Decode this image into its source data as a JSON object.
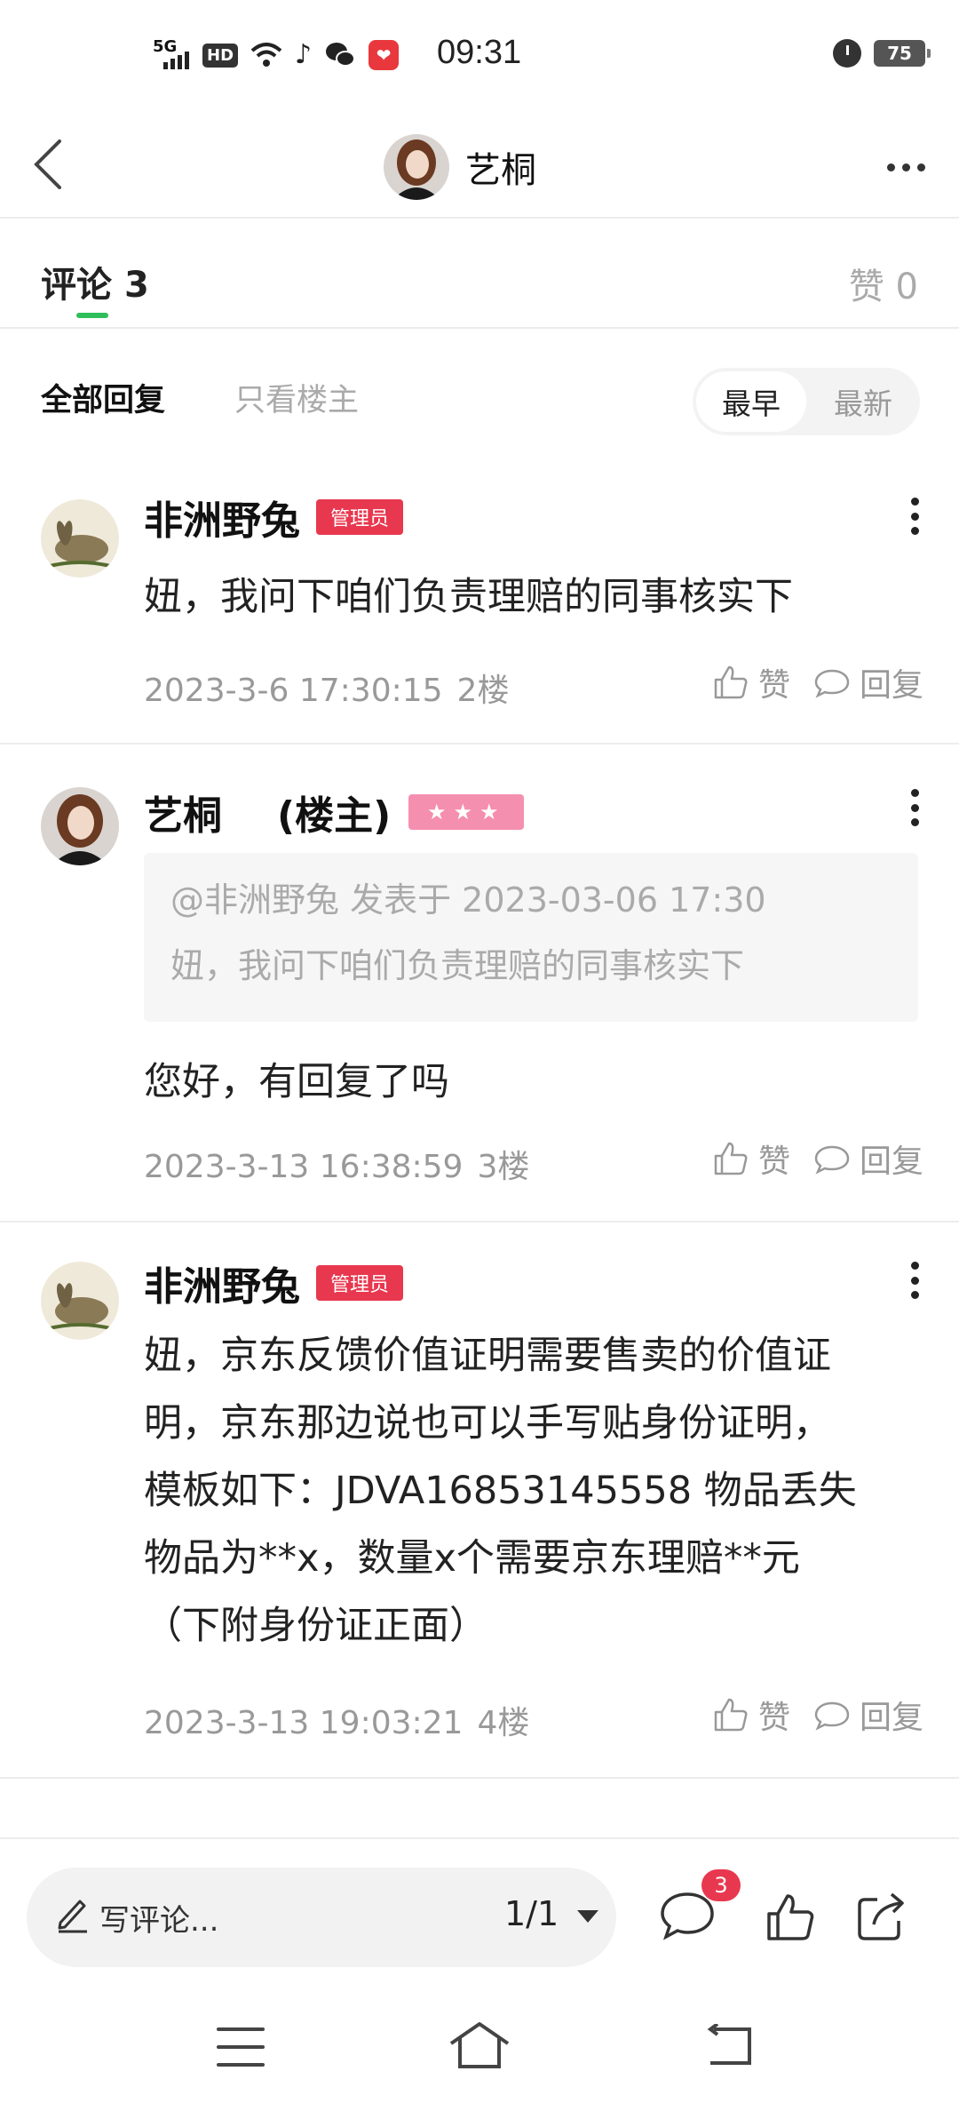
{
  "status_bar": {
    "network": "5G",
    "hd": "HD",
    "time": "09:31",
    "battery": "75",
    "app_icons": [
      "wifi-icon",
      "tiktok-icon",
      "wechat-icon",
      "pinduoduo-icon"
    ]
  },
  "nav": {
    "title": "艺桐"
  },
  "tabs": {
    "comments_label": "评论",
    "comments_count": "3",
    "likes_label": "赞",
    "likes_count": "0"
  },
  "filters": {
    "all_replies": "全部回复",
    "only_op": "只看楼主",
    "sort_earliest": "最早",
    "sort_latest": "最新"
  },
  "action_labels": {
    "like": "赞",
    "reply": "回复"
  },
  "comments": [
    {
      "name": "非洲野兔",
      "badge": "管理员",
      "body": "妞，我问下咱们负责理赔的同事核实下",
      "time": "2023-3-6 17:30:15",
      "floor": "2楼"
    },
    {
      "name": "艺桐",
      "op_label": "(楼主)",
      "badge": "★★★",
      "quote_header": "@非洲野兔 发表于 2023-03-06 17:30",
      "quote_body": "妞，我问下咱们负责理赔的同事核实下",
      "body": "您好，有回复了吗",
      "time": "2023-3-13 16:38:59",
      "floor": "3楼"
    },
    {
      "name": "非洲野兔",
      "badge": "管理员",
      "body_lines": [
        "妞，京东反馈价值证明需要售卖的价值证",
        "明，京东那边说也可以手写贴身份证明，",
        "模板如下：JDVA16853145558 物品丢失",
        "物品为**x，数量x个需要京东理赔**元",
        "（下附身份证正面）"
      ],
      "time": "2023-3-13 19:03:21",
      "floor": "4楼"
    }
  ],
  "bottom_bar": {
    "input_placeholder": "写评论...",
    "page_indicator": "1/1",
    "comment_badge": "3"
  },
  "colors": {
    "accent_green": "#2fbf5a",
    "admin_badge": "#e8384f",
    "star_badge": "#f58fb0"
  }
}
